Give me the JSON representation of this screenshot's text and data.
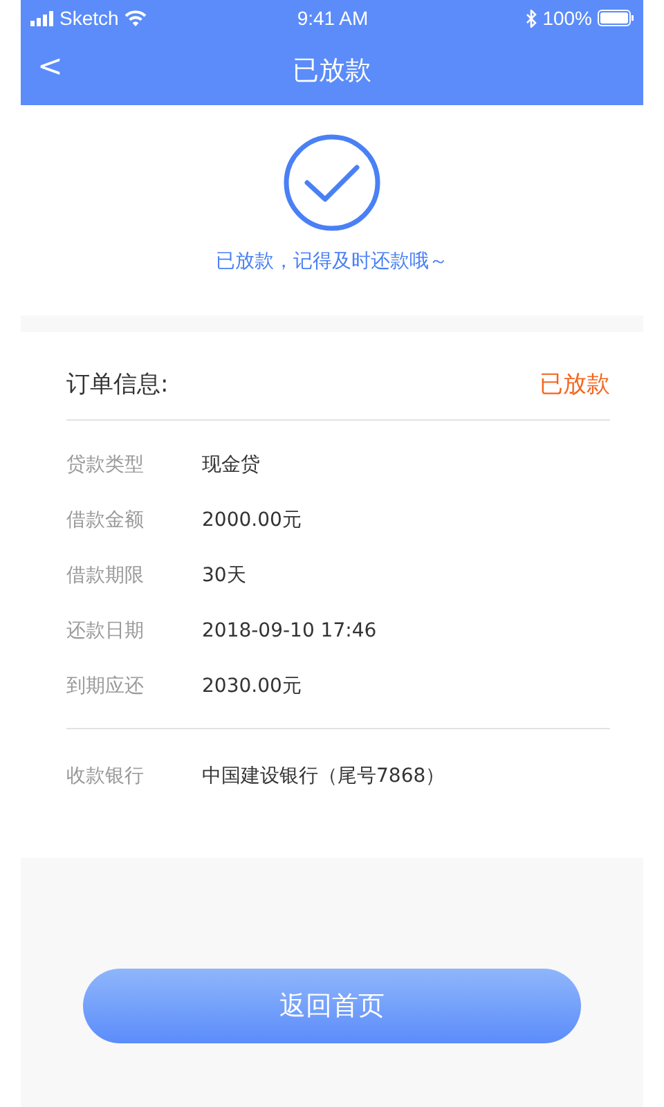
{
  "status_bar": {
    "carrier": "Sketch",
    "time": "9:41 AM",
    "battery": "100%"
  },
  "nav": {
    "back": "<",
    "title": "已放款"
  },
  "result": {
    "message": "已放款，记得及时还款哦～"
  },
  "order": {
    "heading": "订单信息:",
    "status": "已放款",
    "rows": [
      {
        "label": "贷款类型",
        "value": "现金贷"
      },
      {
        "label": "借款金额",
        "value": "2000.00元"
      },
      {
        "label": "借款期限",
        "value": "30天"
      },
      {
        "label": "还款日期",
        "value": "2018-09-10 17:46"
      },
      {
        "label": "到期应还",
        "value": "2030.00元"
      }
    ],
    "bank": {
      "label": "收款银行",
      "value": "中国建设银行（尾号7868）"
    }
  },
  "button": "返回首页"
}
